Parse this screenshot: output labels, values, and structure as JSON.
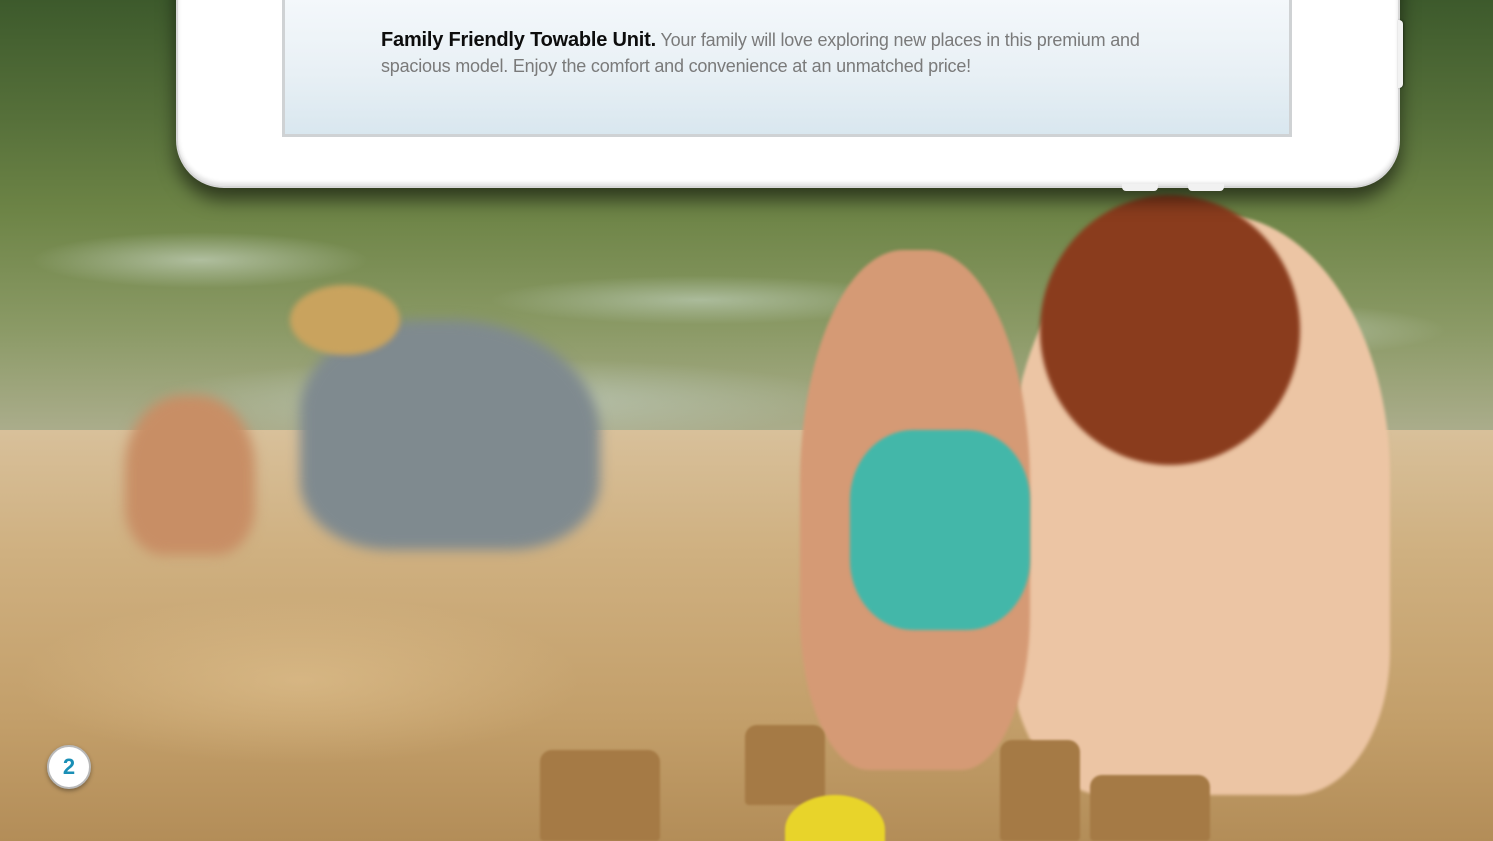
{
  "card": {
    "title": "Family Friendly Towable Unit.",
    "description": "Your family will love exploring new places in this premium and spacious model. Enjoy the comfort and convenience at an unmatched price!"
  },
  "page": {
    "number": "2"
  },
  "photo": {
    "alt_subject": "beach-family-photo"
  },
  "colors": {
    "badge_text": "#1a8fb6",
    "panel_bg": "#e8f0f5",
    "title_text": "#0d0d0d",
    "body_text": "#7a7a7a"
  }
}
